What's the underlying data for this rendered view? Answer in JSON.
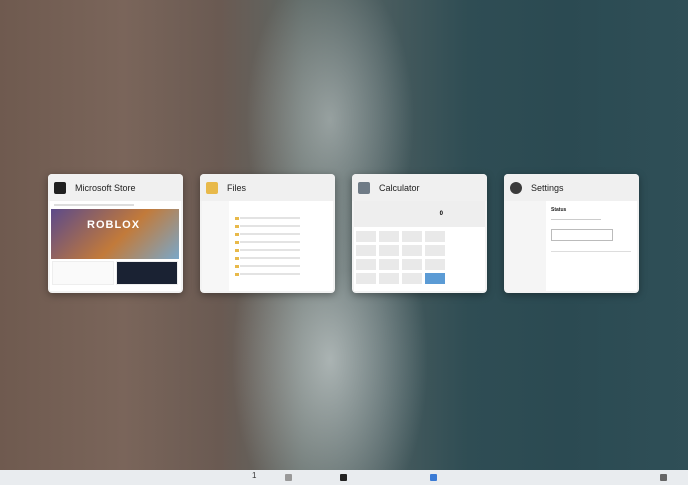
{
  "windows": [
    {
      "title": "Microsoft Store",
      "icon": "store-icon",
      "thumbnail_text": "ROBLOX"
    },
    {
      "title": "Files",
      "icon": "folder-icon"
    },
    {
      "title": "Calculator",
      "icon": "calculator-icon",
      "display_value": "0"
    },
    {
      "title": "Settings",
      "icon": "gear-icon",
      "thumbnail_heading": "Status"
    }
  ],
  "taskbar": {
    "badge": "1"
  },
  "colors": {
    "store": "#1f1f1f",
    "files": "#e8b94a",
    "calculator": "#6f7b86",
    "settings": "#3b3b3b"
  }
}
